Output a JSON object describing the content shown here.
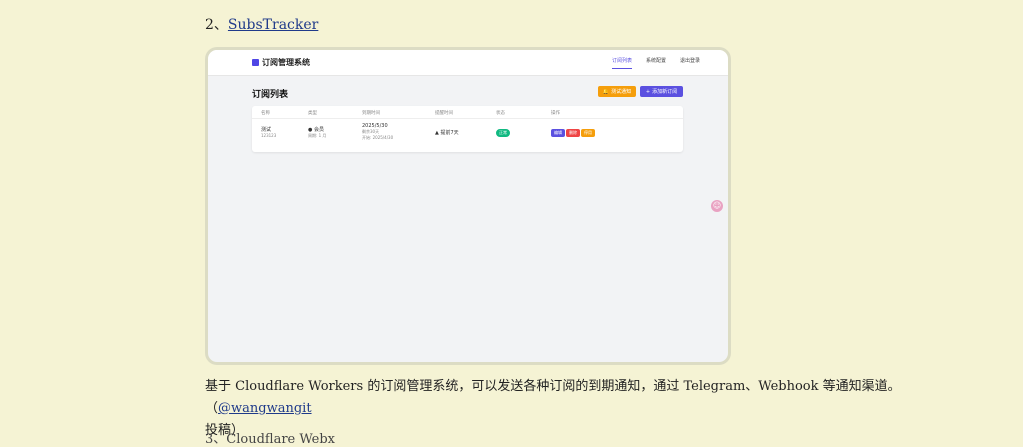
{
  "heading": {
    "prefix": "2、",
    "link": "SubsTracker"
  },
  "app": {
    "brand": "订阅管理系统",
    "nav": [
      "订阅列表",
      "系统配置",
      "退出登录"
    ],
    "page_title": "订阅列表",
    "buttons": {
      "test": "测试通知",
      "add": "添加新订阅"
    },
    "columns": [
      "名称",
      "类型",
      "到期时间",
      "提醒时间",
      "状态",
      "操作"
    ],
    "row": {
      "name": "测试",
      "name_sub": "123123",
      "type": "会员",
      "type_sub": "周期: 1 月",
      "expire": "2025/5/30",
      "expire_sub1": "剩余30天",
      "expire_sub2": "开始: 2025/4/30",
      "remind": "提前7天",
      "status": "正常",
      "actions": [
        "编辑",
        "删除",
        "停用"
      ]
    }
  },
  "float_icon": "emoji-icon",
  "para": {
    "text": "基于 Cloudflare Workers 的订阅管理系统，可以发送各种订阅的到期通知，通过 Telegram、Webhook 等通知渠道。（",
    "link": "@wangwangit",
    "tail": "投稿）"
  },
  "cut_text": "3、Cloudflare Webx"
}
